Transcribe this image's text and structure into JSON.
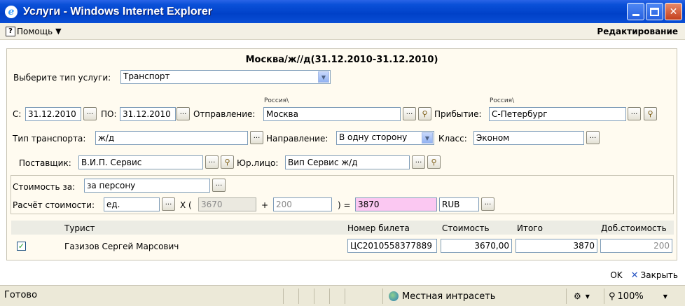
{
  "window": {
    "title": "Услуги - Windows Internet Explorer",
    "logo_letter": "e"
  },
  "menubar": {
    "help": "Помощь",
    "mode": "Редактирование"
  },
  "route": {
    "title": "Москва/ж//д(31.12.2010-31.12.2010)"
  },
  "service_type": {
    "label": "Выберите тип услуги:",
    "value": "Транспорт"
  },
  "dates": {
    "from_label": "С:",
    "from": "31.12.2010",
    "to_label": "ПО:",
    "to": "31.12.2010"
  },
  "departure": {
    "label": "Отправление:",
    "country": "Россия\\",
    "city": "Москва"
  },
  "arrival": {
    "label": "Прибытие:",
    "country": "Россия\\",
    "city": "С-Петербург"
  },
  "transport": {
    "type_label": "Тип транспорта:",
    "type": "ж/д",
    "direction_label": "Направление:",
    "direction": "В одну сторону",
    "class_label": "Класс:",
    "class": "Эконом"
  },
  "supplier": {
    "label": "Поставщик:",
    "value": "В.И.П. Сервис",
    "legal_label": "Юр.лицо:",
    "legal": "Вип Сервис ж/д"
  },
  "cost": {
    "per_label": "Стоимость за:",
    "per": "за персону",
    "calc_label": "Расчёт стоимости:",
    "unit": "ед.",
    "x_open": "X (",
    "base": "3670",
    "plus": "+",
    "extra": "200",
    "close_eq": ") =",
    "total": "3870",
    "currency": "RUB"
  },
  "table": {
    "headers": [
      "Турист",
      "Номер билета",
      "Стоимость",
      "Итого",
      "Доб.стоимость"
    ],
    "rows": [
      {
        "checked": true,
        "tourist": "Газизов Сергей Марсович",
        "ticket": "ЦС2010558377889",
        "price": "3670,00",
        "total": "3870",
        "extra": "200"
      }
    ]
  },
  "footer": {
    "ok": "OK",
    "close": "Закрыть"
  },
  "status": {
    "ready": "Готово",
    "zone": "Местная интрасеть",
    "zoom": "100%"
  },
  "btn": {
    "ellipsis": "...",
    "dropdown_arrow": "▼",
    "check": "✓"
  },
  "icons": {
    "search": "search-icon",
    "globe": "globe-icon",
    "help": "help-icon"
  }
}
